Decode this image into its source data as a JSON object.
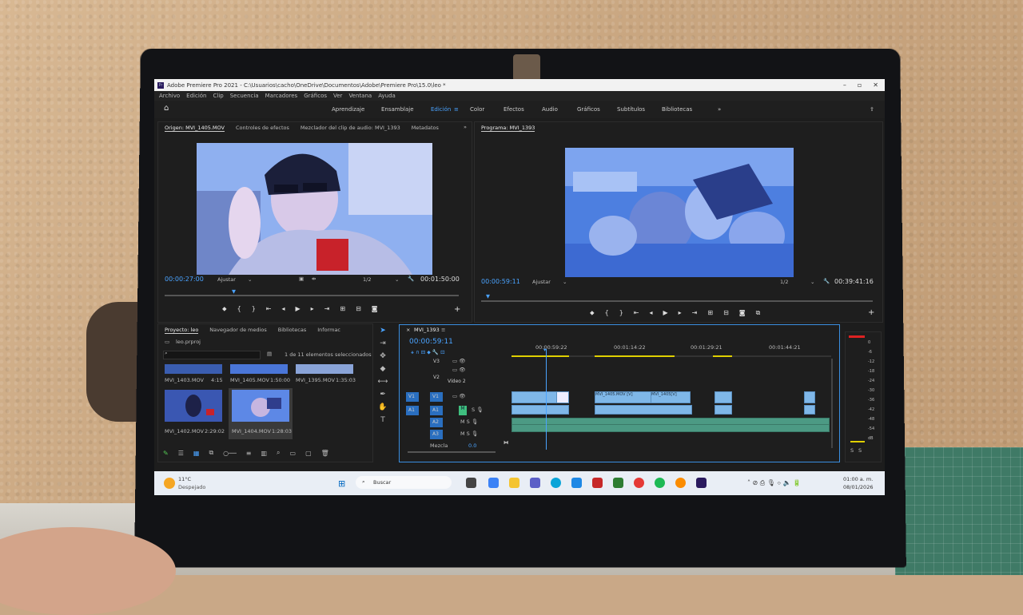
{
  "window": {
    "title": "Adobe Premiere Pro 2021 - C:\\Usuarios\\cacho\\OneDrive\\Documentos\\Adobe\\Premiere Pro\\15.0\\leo *"
  },
  "menu": [
    "Archivo",
    "Edición",
    "Clip",
    "Secuencia",
    "Marcadores",
    "Gráficos",
    "Ver",
    "Ventana",
    "Ayuda"
  ],
  "workspaces": {
    "items": [
      "Aprendizaje",
      "Ensamblaje",
      "Edición",
      "Color",
      "Efectos",
      "Audio",
      "Gráficos",
      "Subtítulos",
      "Bibliotecas"
    ],
    "active": "Edición"
  },
  "source_panel": {
    "tabs": [
      "Origen: MVI_1405.MOV",
      "Controles de efectos",
      "Mezclador del clip de audio: MVI_1393",
      "Metadatos"
    ],
    "timecode": "00:00:27:00",
    "fit": "Ajustar",
    "resolution": "1/2",
    "duration": "00:01:50:00"
  },
  "program_panel": {
    "tab": "Programa: MVI_1393",
    "timecode": "00:00:59:11",
    "fit": "Ajustar",
    "resolution": "1/2",
    "duration": "00:39:41:16"
  },
  "project_panel": {
    "tabs": [
      "Proyecto: leo",
      "Navegador de medios",
      "Bibliotecas",
      "Informac"
    ],
    "file": "leo.prproj",
    "selection": "1 de 11 elementos seleccionados",
    "items": [
      {
        "name": "MVI_1403.MOV",
        "dur": "4:15"
      },
      {
        "name": "MVI_1405.MOV",
        "dur": "1:50:00"
      },
      {
        "name": "MVI_1395.MOV",
        "dur": "1:35:03"
      },
      {
        "name": "MVI_1402.MOV",
        "dur": "2:29:02"
      },
      {
        "name": "MVI_1404.MOV",
        "dur": "1:28:03"
      }
    ]
  },
  "timeline": {
    "tab": "MVI_1393",
    "timecode": "00:00:59:11",
    "ruler": [
      "00:00:59:22",
      "00:01:14:22",
      "00:01:29:21",
      "00:01:44:21"
    ],
    "tracks": {
      "v3": "V3",
      "v2": "V2",
      "v2_name": "Vídeo 2",
      "v1": "V1",
      "a1": "A1",
      "a2": "A2",
      "a3": "A3",
      "src_v1": "V1",
      "src_a1": "A1",
      "mix": "Mezcla",
      "mix_value": "0.0"
    },
    "clip_labels": [
      "MVI_1405.MOV [V]",
      "MVI_1405[V]"
    ]
  },
  "meter": {
    "scale": [
      "0",
      "-6",
      "-12",
      "-18",
      "-24",
      "-30",
      "-36",
      "-42",
      "-48",
      "-54",
      "dB"
    ],
    "solo": [
      "S",
      "S"
    ]
  },
  "taskbar": {
    "weather_temp": "11°C",
    "weather_desc": "Despejado",
    "search": "Buscar",
    "time": "01:00 a. m.",
    "date": "08/01/2026"
  }
}
